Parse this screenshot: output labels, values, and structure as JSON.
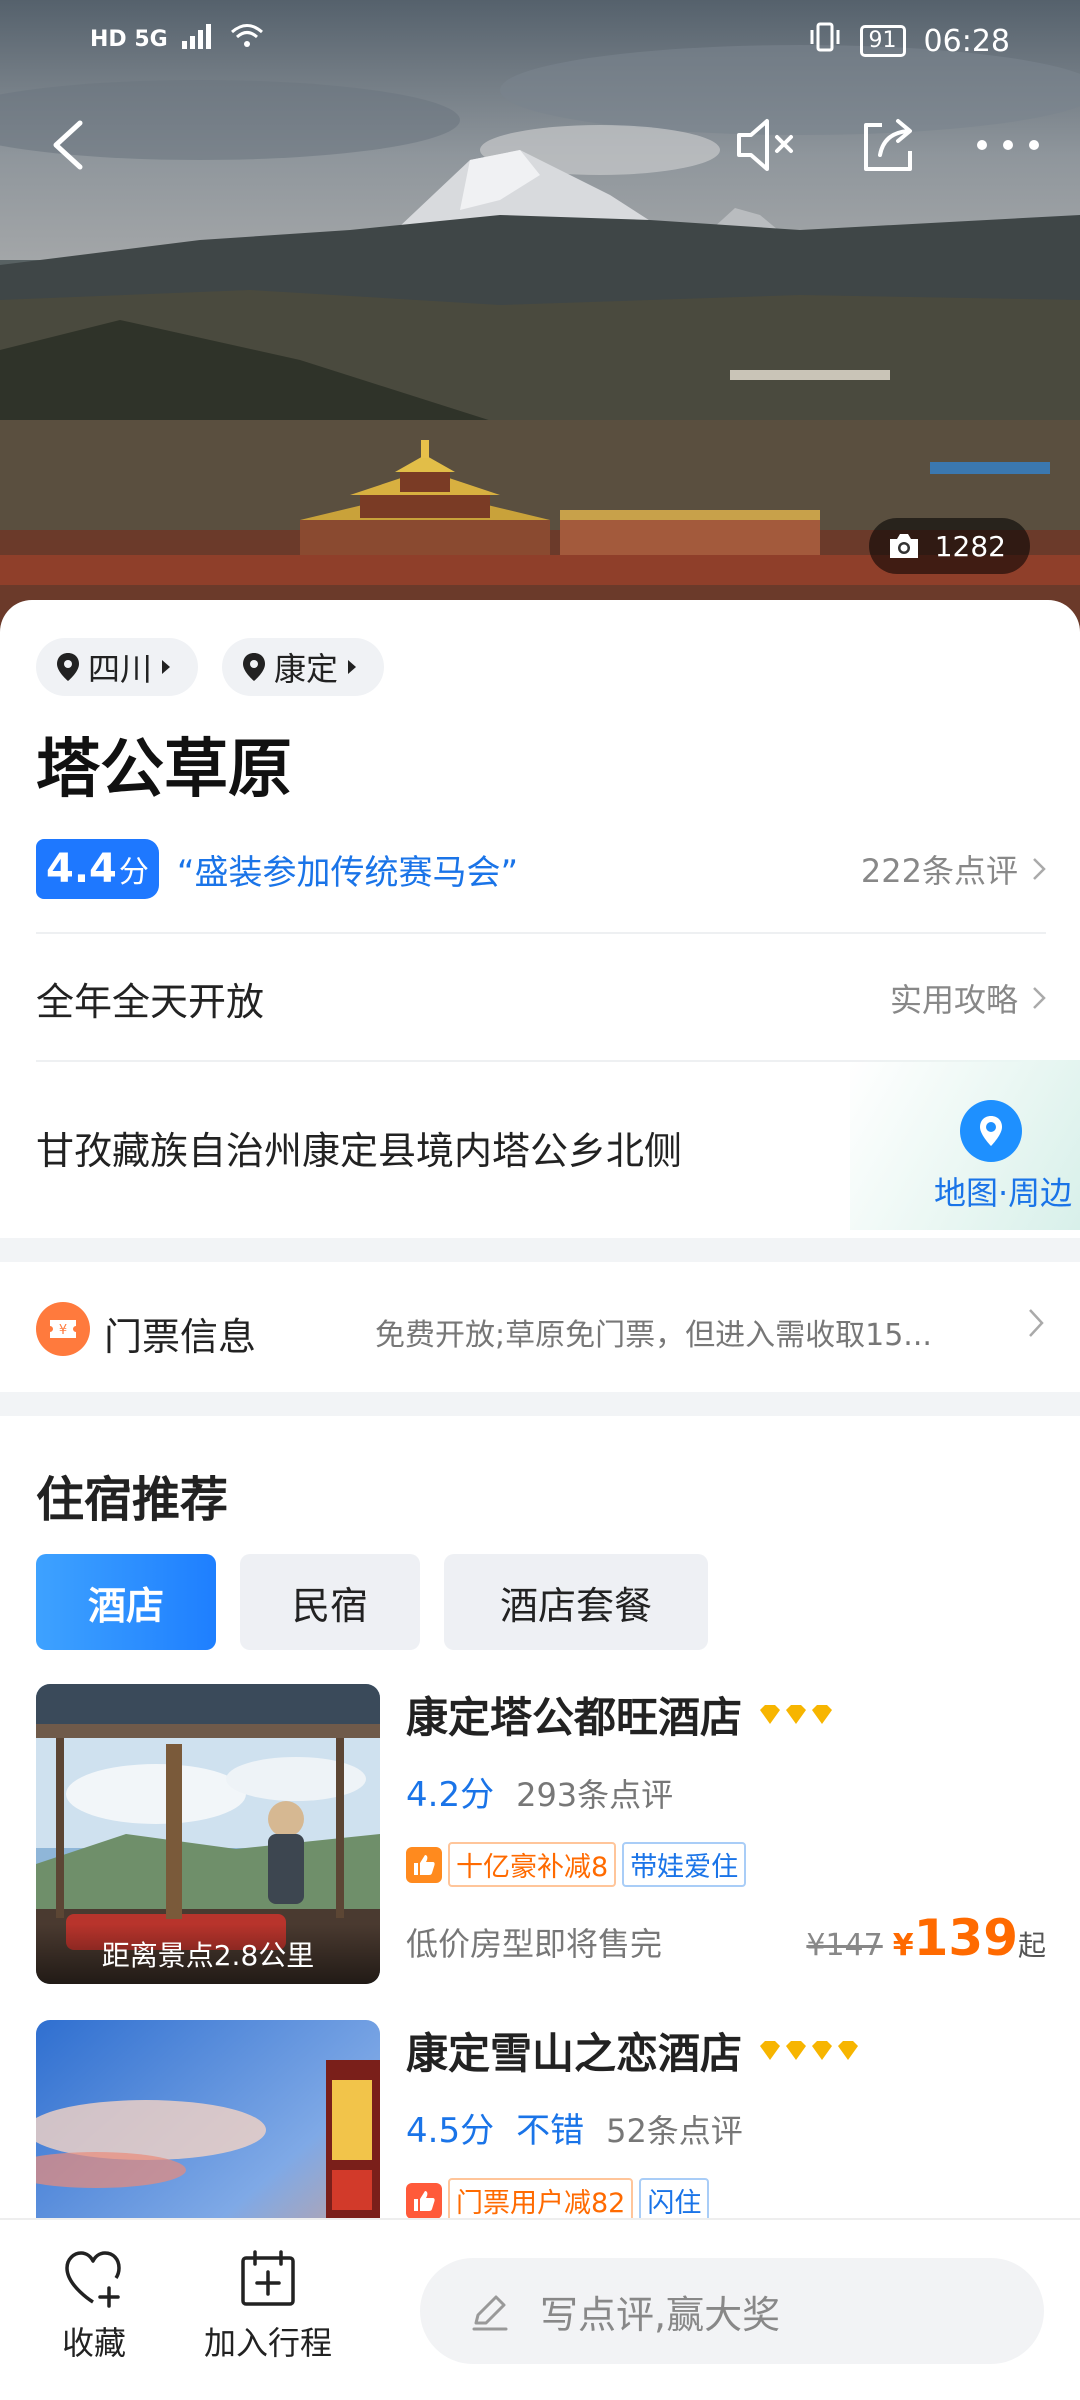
{
  "status_bar": {
    "left_text": "HD 5G",
    "battery": "91",
    "time": "06:28"
  },
  "hero": {
    "photo_count": "1282"
  },
  "location_chips": [
    {
      "label": "四川"
    },
    {
      "label": "康定"
    }
  ],
  "attraction": {
    "title": "塔公草原",
    "score": "4.4",
    "score_unit": "分",
    "quote": "“盛装参加传统赛马会”",
    "reviews": "222条点评",
    "open_hours": "全年全天开放",
    "guide_link": "实用攻略",
    "address": "甘孜藏族自治州康定县境内塔公乡北侧",
    "map_link": "地图·周边"
  },
  "ticket": {
    "label": "门票信息",
    "description": "免费开放;草原免门票，但进入需收取15..."
  },
  "lodging": {
    "title": "住宿推荐",
    "tabs": [
      {
        "label": "酒店",
        "active": true
      },
      {
        "label": "民宿",
        "active": false
      },
      {
        "label": "酒店套餐",
        "active": false
      }
    ],
    "hotels": [
      {
        "name": "康定塔公都旺酒店",
        "diamonds": 3,
        "score": "4.2分",
        "score_word": "",
        "reviews": "293条点评",
        "tags_orange": "十亿豪补减8",
        "tags_blue": "带娃爱住",
        "distance": "距离景点2.8公里",
        "stock_note": "低价房型即将售完",
        "orig_price": "¥147",
        "currency": "¥",
        "price": "139",
        "price_suffix": "起"
      },
      {
        "name": "康定雪山之恋酒店",
        "diamonds": 4,
        "score": "4.5分",
        "score_word": "不错",
        "reviews": "52条点评",
        "tags_orange": "门票用户减82",
        "tags_blue": "闪住"
      }
    ]
  },
  "bottom_bar": {
    "favorite_label": "收藏",
    "itinerary_label": "加入行程",
    "review_placeholder": "写点评,赢大奖"
  },
  "colors": {
    "accent_blue": "#1e78ff",
    "price_orange": "#ff6a00",
    "ticket_orange": "#ff7a3d"
  }
}
